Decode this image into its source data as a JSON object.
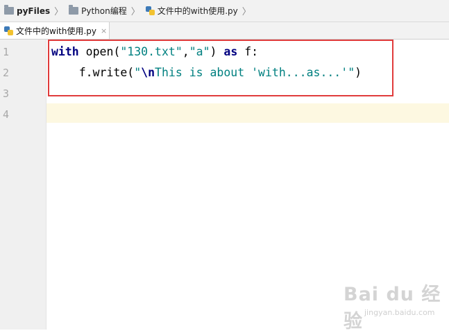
{
  "breadcrumb": {
    "items": [
      {
        "label": "pyFiles"
      },
      {
        "label": "Python编程"
      },
      {
        "label": "文件中的with使用.py"
      }
    ],
    "separator": "〉"
  },
  "tab": {
    "label": "文件中的with使用.py",
    "close_glyph": "×"
  },
  "line_numbers": [
    "1",
    "2",
    "3",
    "4"
  ],
  "code": {
    "line1": {
      "kw_with": "with",
      "open_call": " open(",
      "str1": "\"130.txt\"",
      "comma": ",",
      "str2": "\"a\"",
      "close_paren": ") ",
      "kw_as": "as",
      "target": " f:"
    },
    "line2": {
      "indent_call": "    f.write(",
      "q_open": "\"",
      "escape": "\\n",
      "str_body": "This is about 'with...as...'",
      "q_close": "\"",
      "close_paren": ")"
    }
  },
  "watermark": {
    "logo_text": "Bai du 经验",
    "url": "jingyan.baidu.com"
  },
  "colors": {
    "keyword": "#000080",
    "string": "#008080",
    "annotation_border": "#e03b3b",
    "caret_line": "#fdf8e1"
  }
}
